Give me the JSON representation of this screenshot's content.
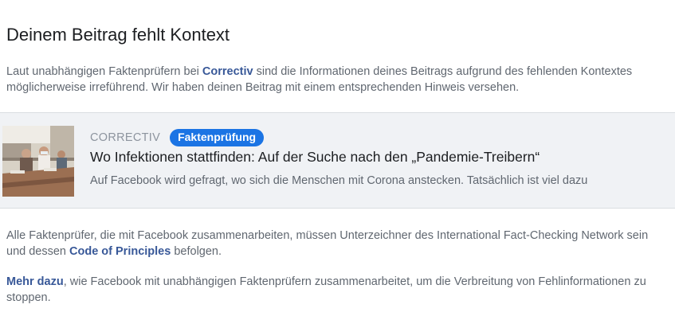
{
  "header": {
    "title": "Deinem Beitrag fehlt Kontext"
  },
  "intro": {
    "text_before": "Laut unabhängigen Faktenprüfern bei ",
    "link": "Correctiv",
    "text_after": " sind die Informationen deines Beitrags aufgrund des fehlenden Kontextes möglicherweise irreführend. Wir haben deinen Beitrag mit einem entsprechenden Hinweis versehen."
  },
  "card": {
    "publisher": "CORRECTIV",
    "badge": "Faktenprüfung",
    "title": "Wo Infektionen stattfinden: Auf der Suche nach den „Pandemie-Treibern“",
    "description": "Auf Facebook wird gefragt, wo sich die Menschen mit Corona anstecken. Tatsächlich ist viel dazu",
    "thumbnail": "classroom-photo"
  },
  "principles": {
    "text_before": "Alle Faktenprüfer, die mit Facebook zusammenarbeiten, müssen Unterzeichner des International Fact-Checking Network sein und dessen ",
    "link": "Code of Principles",
    "text_after": " befolgen."
  },
  "more": {
    "link": "Mehr dazu",
    "text_after": ", wie Facebook mit unabhängigen Faktenprüfern zusammenarbeitet, um die Verbreitung von Fehlinformationen zu stoppen."
  },
  "colors": {
    "link": "#385898",
    "badge": "#1b74e4",
    "card_bg": "#f0f2f5",
    "text_primary": "#1c1e21",
    "text_secondary": "#606770"
  }
}
